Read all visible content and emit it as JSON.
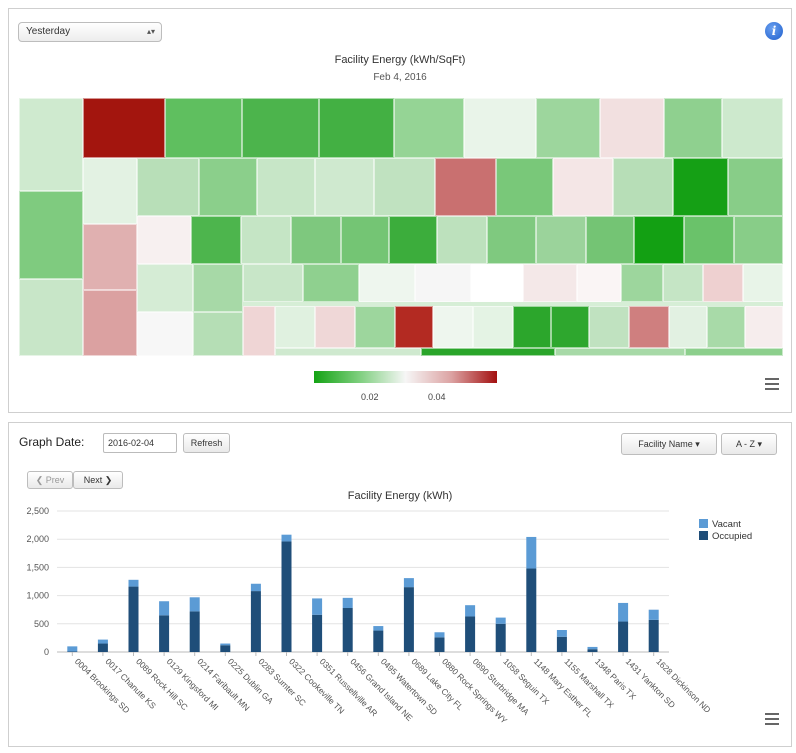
{
  "top_panel": {
    "period_select": "Yesterday",
    "title": "Facility Energy (kWh/SqFt)",
    "date": "Feb 4, 2016",
    "legend_ticks": [
      "0.02",
      "0.04"
    ],
    "colors": {
      "low": "#14a314",
      "mid": "#f6f6f6",
      "high": "#a31010"
    }
  },
  "bottom_panel": {
    "graph_date_label": "Graph Date:",
    "graph_date_value": "2016-02-04",
    "refresh_label": "Refresh",
    "sort_field_label": "Facility Name",
    "sort_order_label": "A - Z",
    "prev_label": "Prev",
    "next_label": "Next"
  },
  "chart_data": {
    "type": "bar",
    "stacked": true,
    "title": "Facility Energy (kWh)",
    "xlabel": "",
    "ylabel": "",
    "ylim": [
      0,
      2500
    ],
    "yticks": [
      "0",
      "500",
      "1,000",
      "1,500",
      "2,000",
      "2,500"
    ],
    "grid": true,
    "legend_position": "top-right",
    "categories": [
      "0004 Brookings SD",
      "0017 Chanute KS",
      "0089 Rock Hill SC",
      "0129 Kingsford MI",
      "0214 Faribault MN",
      "0225 Dublin GA",
      "0283 Sumter SC",
      "0322 Cookeville TN",
      "0351 Russellville AR",
      "0456 Grand Island NE",
      "0495 Watertown SD",
      "0689 Lake City FL",
      "0880 Rock Springs WY",
      "0890 Sturbridge MA",
      "1058 Seguin TX",
      "1148 Mary Esther FL",
      "1155 Marshall TX",
      "1348 Paris TX",
      "1431 Yankton SD",
      "1628 Dickinson ND"
    ],
    "series": [
      {
        "name": "Vacant",
        "color": "#5b9bd5",
        "values": [
          90,
          70,
          120,
          250,
          250,
          30,
          130,
          120,
          290,
          180,
          80,
          160,
          90,
          200,
          110,
          560,
          120,
          40,
          330,
          180
        ]
      },
      {
        "name": "Occupied",
        "color": "#1f4e79",
        "values": [
          10,
          150,
          1160,
          650,
          720,
          120,
          1080,
          1960,
          660,
          780,
          380,
          1150,
          260,
          630,
          500,
          1480,
          270,
          50,
          540,
          570
        ]
      }
    ]
  }
}
